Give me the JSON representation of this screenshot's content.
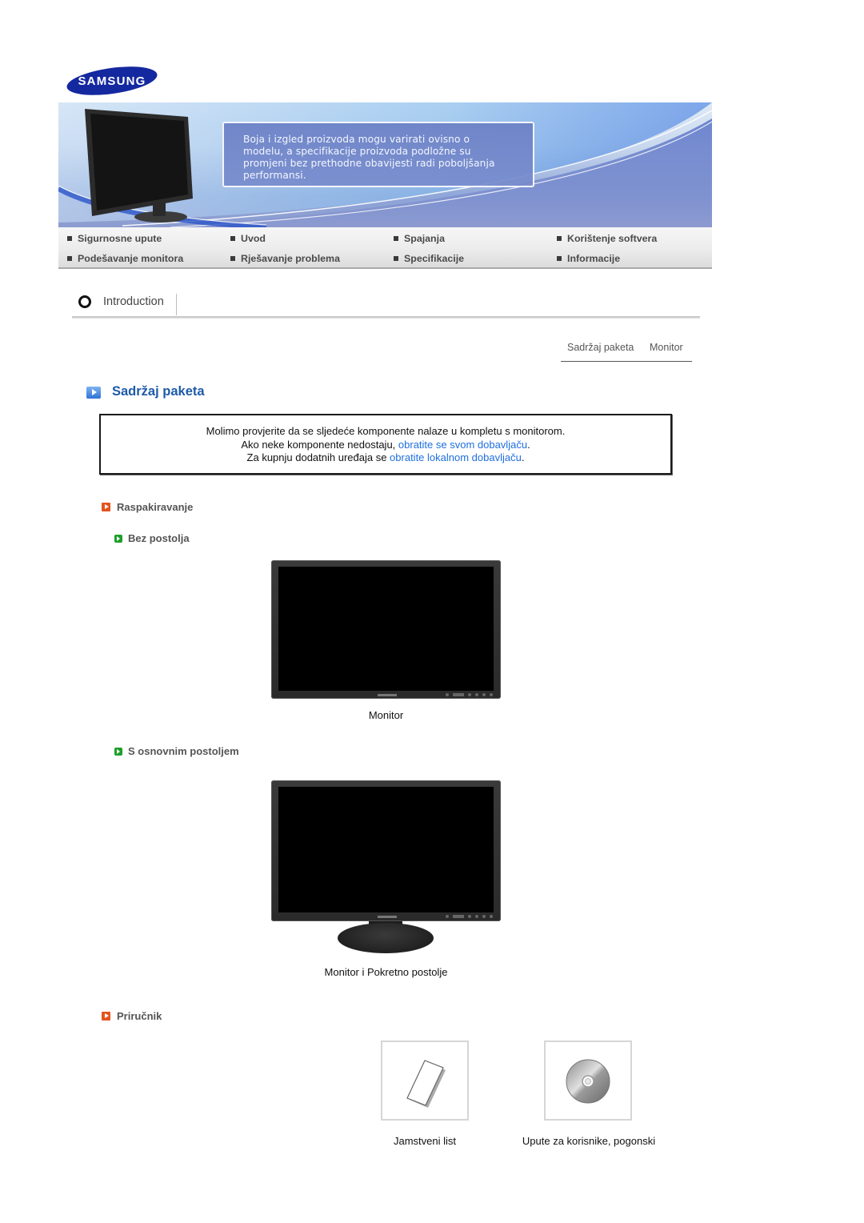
{
  "brand": {
    "logo_text": "SAMSUNG",
    "logo_color": "#1428a0"
  },
  "banner": {
    "notice_lines": [
      "Boja i izgled proizvoda mogu varirati ovisno o",
      "modelu, a specifikacije proizvoda podložne su",
      "promjeni bez prethodne obavijesti radi poboljšanja",
      "performansi."
    ]
  },
  "nav": {
    "items": [
      {
        "label": "Sigurnosne upute"
      },
      {
        "label": "Uvod"
      },
      {
        "label": "Spajanja"
      },
      {
        "label": "Korištenje softvera"
      },
      {
        "label": "Podešavanje monitora"
      },
      {
        "label": "Rješavanje problema"
      },
      {
        "label": "Specifikacije"
      },
      {
        "label": "Informacije"
      }
    ]
  },
  "section_bar": {
    "label": "Introduction"
  },
  "subtabs": [
    {
      "label": "Sadržaj paketa"
    },
    {
      "label": "Monitor"
    }
  ],
  "page": {
    "title": "Sadržaj paketa",
    "notice": {
      "line1": "Molimo provjerite da se sljedeće komponente nalaze u kompletu s monitorom.",
      "line2_prefix": "Ako neke komponente nedostaju, ",
      "line2_link": "obratite se svom dobavljaču",
      "line2_suffix": ".",
      "line3_prefix": "Za kupnju dodatnih uređaja se ",
      "line3_link": "obratite lokalnom dobavljaču",
      "line3_suffix": "."
    },
    "unpacking": {
      "heading": "Raspakiravanje",
      "without_stand": {
        "heading": "Bez postolja",
        "caption": "Monitor"
      },
      "with_stand": {
        "heading": "S osnovnim postoljem",
        "caption": "Monitor i Pokretno postolje"
      }
    },
    "manual": {
      "heading": "Priručnik",
      "items": [
        {
          "icon": "warranty-card-icon",
          "caption": "Jamstveni list"
        },
        {
          "icon": "cd-disc-icon",
          "caption": "Upute za korisnike, pogonski"
        }
      ]
    }
  }
}
